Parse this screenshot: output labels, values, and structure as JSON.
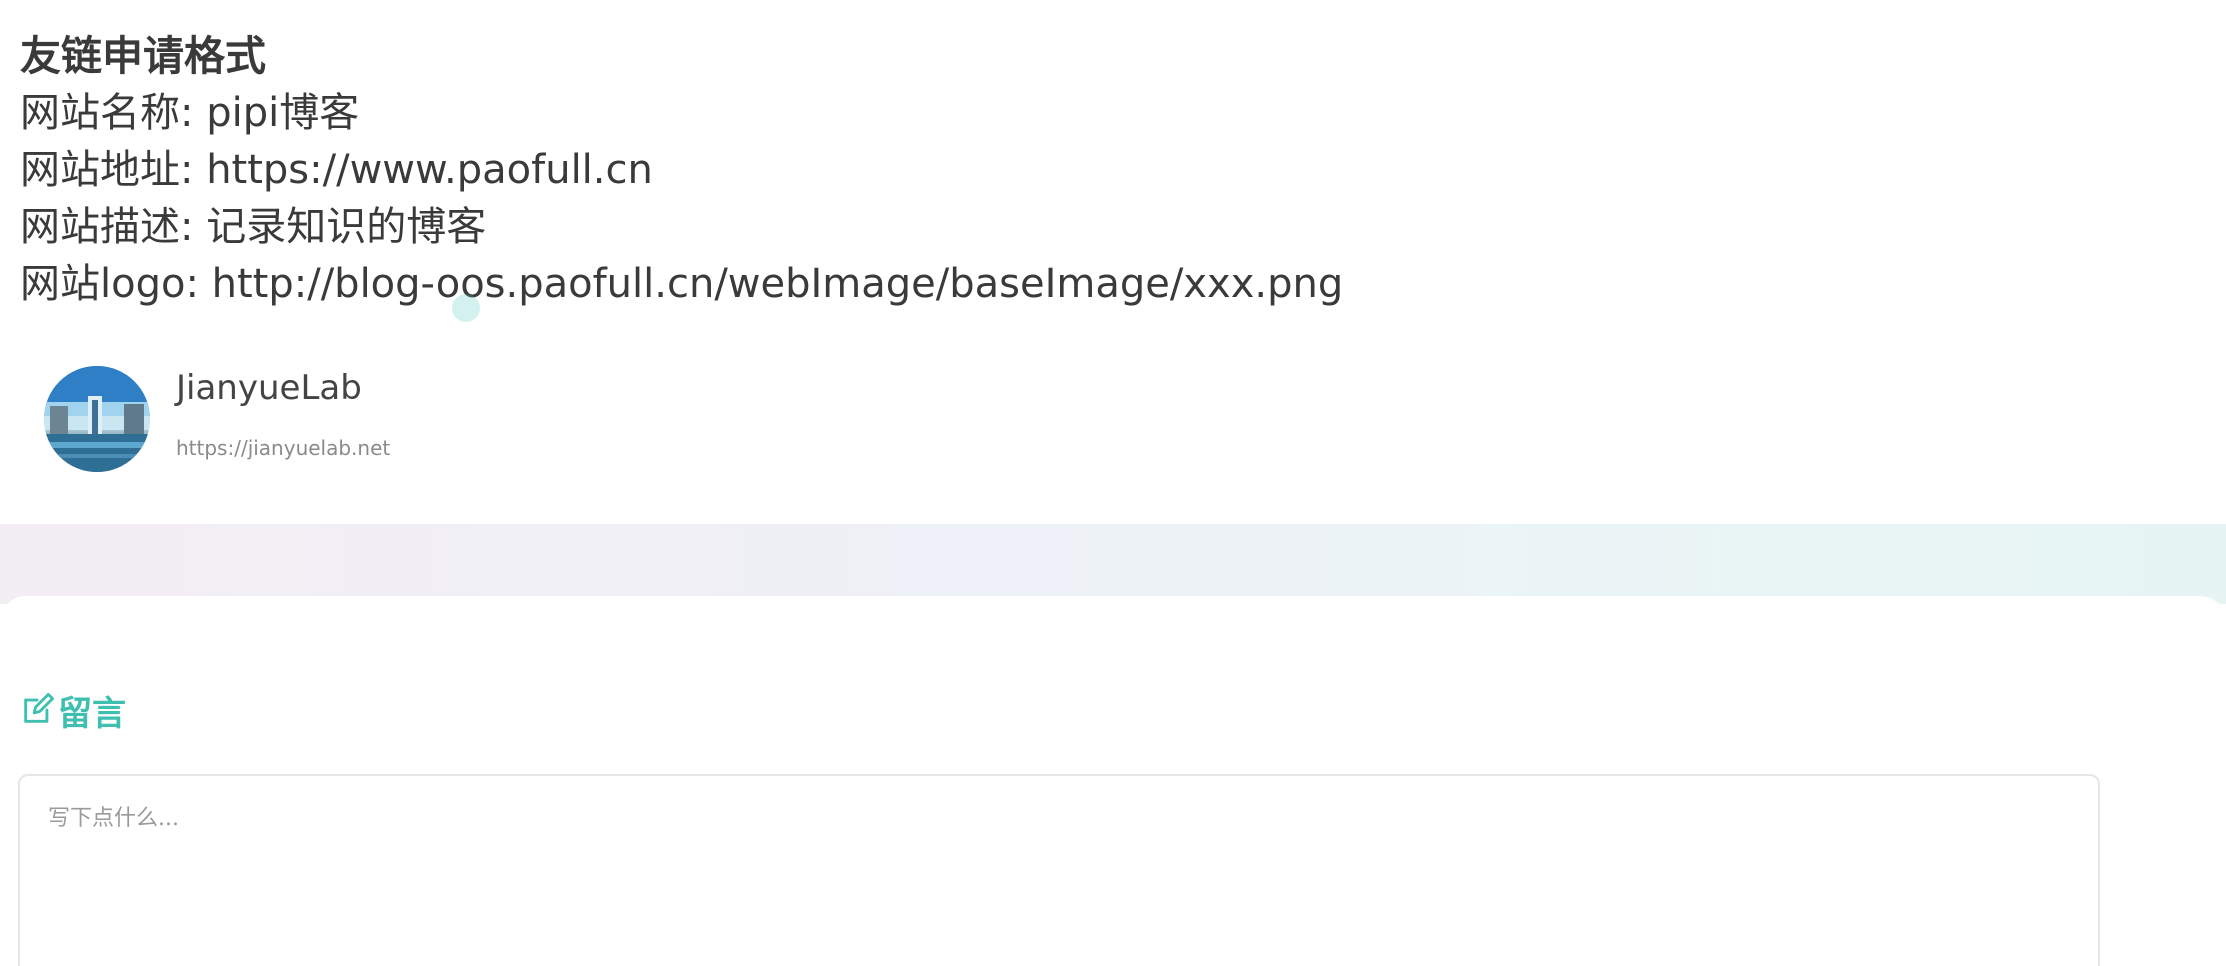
{
  "format": {
    "title": "友链申请格式",
    "lines": [
      "网站名称: pipi博客",
      "网站地址: https://www.paofull.cn",
      "网站描述: 记录知识的博客",
      "网站logo: http://blog-oos.paofull.cn/webImage/baseImage/xxx.png"
    ]
  },
  "friend": {
    "name": "JianyueLab",
    "url": "https://jianyuelab.net",
    "avatar_icon": "landscape-avatar"
  },
  "comment": {
    "heading": "留言",
    "heading_icon": "edit-icon",
    "placeholder": "写下点什么...",
    "value": ""
  },
  "colors": {
    "accent": "#3fbfb0",
    "text": "#3a3a3a",
    "muted": "#8a8a8a"
  }
}
